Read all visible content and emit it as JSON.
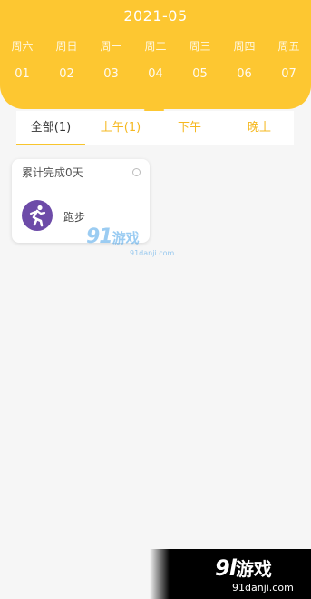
{
  "header": {
    "month": "2021-05",
    "weekdays": [
      "周六",
      "周日",
      "周一",
      "周二",
      "周三",
      "周四",
      "周五"
    ],
    "dates": [
      "01",
      "02",
      "03",
      "04",
      "05",
      "06",
      "07"
    ],
    "selected_index": 3,
    "color": "#fdc731"
  },
  "tabs": [
    {
      "label": "全部(1)",
      "active": true
    },
    {
      "label": "上午(1)",
      "active": false
    },
    {
      "label": "下午",
      "active": false
    },
    {
      "label": "晚上",
      "active": false
    }
  ],
  "card": {
    "title": "累计完成0天",
    "task_label": "跑步",
    "icon": "running-person-icon",
    "icon_color": "#6d4ba8"
  },
  "watermark": {
    "logo_number": "91",
    "logo_text": "游戏",
    "url": "91danji.com"
  },
  "corner_watermark": {
    "logo_number": "9l",
    "logo_text": "游戏",
    "url": "91danji.com"
  }
}
